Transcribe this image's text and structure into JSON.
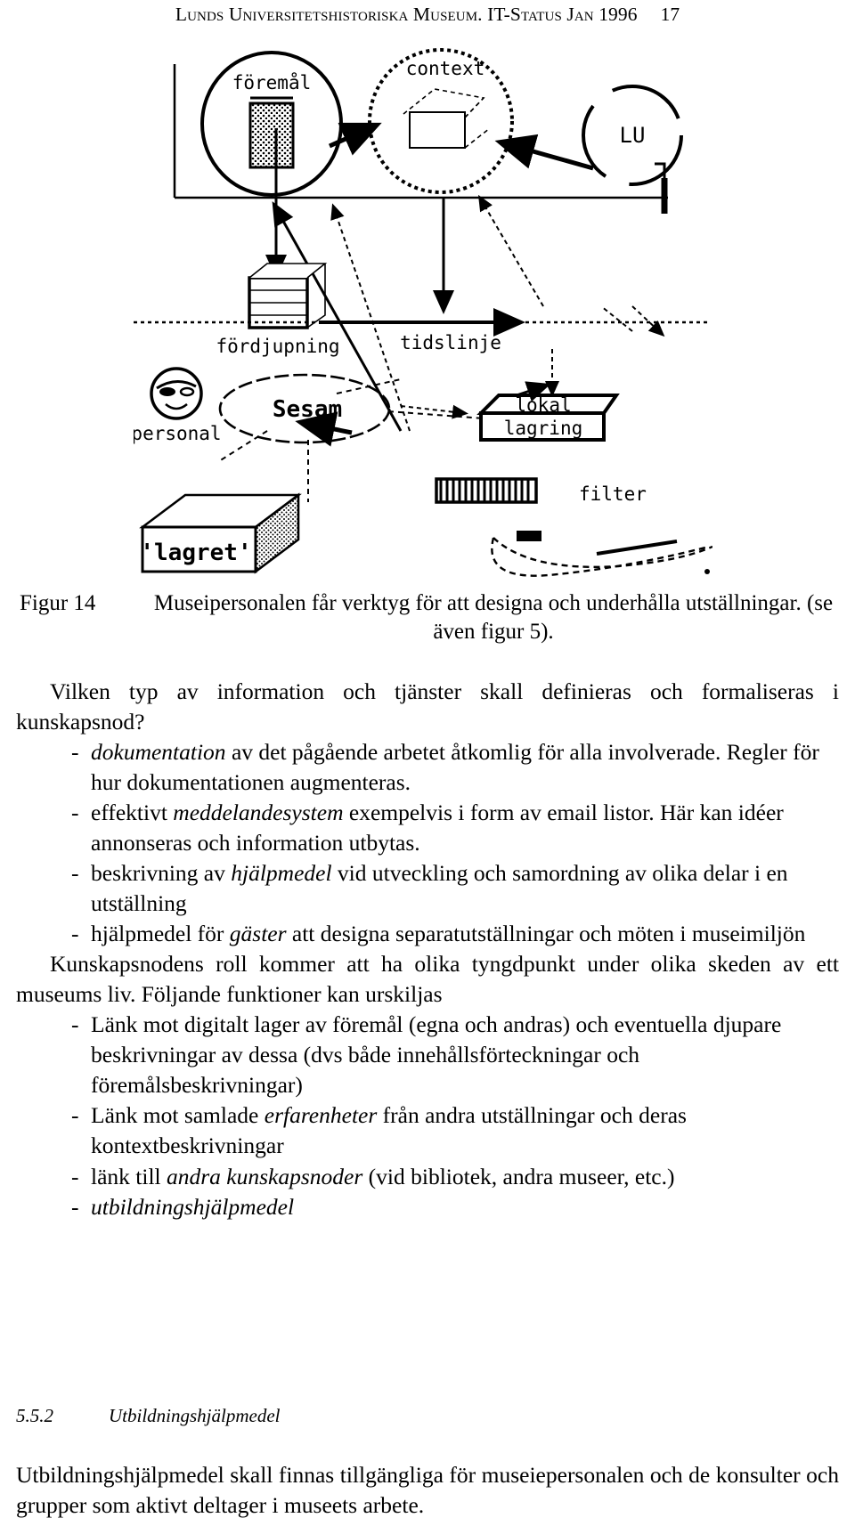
{
  "header": {
    "title": "Lunds Universitetshistoriska Museum. IT-Status Jan 1996",
    "page_number": "17"
  },
  "figure": {
    "labels": {
      "foremal": "föremål",
      "context": "context",
      "lu": "LU",
      "fordjupning": "fördjupning",
      "tidslinje": "tidslinje",
      "personal": "personal",
      "sesam": "Sesam",
      "lagret": "'lagret'",
      "lokal": "lokal",
      "lagring": "lagring",
      "filter": "filter"
    },
    "caption_number": "Figur 14",
    "caption_text": "Museipersonalen får verktyg för att designa och underhålla utställningar. (se även figur 5)."
  },
  "body": {
    "intro_paragraph": "Vilken typ av information och tjänster skall definieras och formaliseras i kunskapsnod?",
    "bullets_first": [
      {
        "italic_lead": "dokumentation",
        "rest": " av det pågående arbetet åtkomlig för alla involverade. Regler för hur dokumentationen augmenteras.",
        "prefix": ""
      },
      {
        "prefix": "effektivt ",
        "italic_lead": "meddelandesystem",
        "rest": " exempelvis i form av email listor. Här kan idéer annonseras och information utbytas."
      },
      {
        "prefix": "beskrivning av ",
        "italic_lead": "hjälpmedel",
        "rest": " vid utveckling och samordning av olika delar i en utställning"
      },
      {
        "prefix": "hjälpmedel för ",
        "italic_lead": "gäster",
        "rest": " att designa separatutställningar och möten i museimiljön"
      }
    ],
    "middle_paragraph": "Kunskapsnodens roll kommer att ha olika tyngdpunkt under olika skeden av ett museums liv. Följande funktioner kan urskiljas",
    "bullets_second": [
      {
        "prefix": "Länk mot digitalt lager av föremål (egna och andras) och eventuella djupare beskrivningar av dessa (dvs både innehållsförteckningar och föremålsbeskrivningar)",
        "italic_lead": "",
        "rest": ""
      },
      {
        "prefix": "Länk mot samlade ",
        "italic_lead": "erfarenheter",
        "rest": " från andra utställningar och deras kontextbeskrivningar"
      },
      {
        "prefix": "länk till ",
        "italic_lead": "andra kunskapsnoder",
        "rest": " (vid bibliotek, andra museer, etc.)"
      },
      {
        "prefix": "",
        "italic_lead": "utbildningshjälpmedel",
        "rest": ""
      }
    ],
    "section": {
      "number": "5.5.2",
      "title": "Utbildningshjälpmedel"
    },
    "closing_paragraph": "Utbildningshjälpmedel skall finnas tillgängliga för museiepersonalen och de konsulter och grupper som aktivt deltager i museets arbete."
  }
}
